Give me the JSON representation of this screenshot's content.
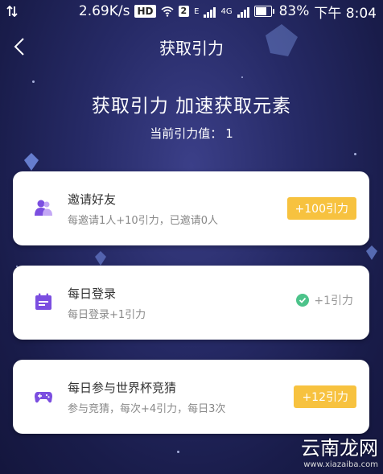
{
  "status_bar": {
    "network_speed": "2.69K/s",
    "hd_badge": "HD",
    "sim_slot": "2",
    "e_label": "E",
    "lte_label": "4G",
    "battery": "83%",
    "battery_fraction": 0.83,
    "time": "下午 8:04"
  },
  "nav": {
    "title": "获取引力"
  },
  "header": {
    "headline": "获取引力 加速获取元素",
    "current_label": "当前引力值：",
    "current_value": "1"
  },
  "tasks": [
    {
      "title": "邀请好友",
      "desc": "每邀请1人+10引力，已邀请0人",
      "reward": "+100引力",
      "status": "available",
      "icon": "invite-friend-icon"
    },
    {
      "title": "每日登录",
      "desc": "每日登录+1引力",
      "reward": "+1引力",
      "status": "done",
      "icon": "calendar-icon"
    },
    {
      "title": "每日参与世界杯竞猜",
      "desc": "参与竞猜，每次+4引力，每日3次",
      "reward": "+12引力",
      "status": "available",
      "icon": "gamepad-icon"
    }
  ],
  "watermark": {
    "cn": "云南龙网",
    "en": "www.xiazaiba.com"
  },
  "colors": {
    "accent_yellow": "#f7c23f",
    "icon_purple": "#7b4ee0",
    "done_green": "#4cc38a",
    "background_deep": "#1a1d4d"
  }
}
